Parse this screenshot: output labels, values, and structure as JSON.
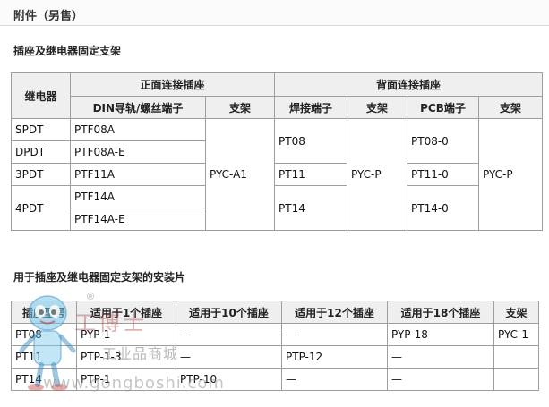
{
  "header": {
    "title": "附件（另售）"
  },
  "section1": {
    "title": "插座及继电器固定支架",
    "group_headers": {
      "relay": "继电器",
      "front": "正面连接插座",
      "back": "背面连接插座"
    },
    "sub_headers": {
      "din_screw": "DIN导轨/螺丝端子",
      "bracket1": "支架",
      "solder": "焊接端子",
      "bracket2": "支架",
      "pcb": "PCB端子",
      "bracket3": "支架"
    },
    "relays": [
      "SPDT",
      "DPDT",
      "3PDT",
      "4PDT"
    ],
    "din_sockets": [
      "PTF08A",
      "PTF08A-E",
      "PTF11A",
      "PTF14A",
      "PTF14A-E"
    ],
    "front_bracket": "PYC-A1",
    "solder_sockets": [
      "PT08",
      "PT11",
      "PT14"
    ],
    "back_bracket_solder": "PYC-P",
    "pcb_sockets": [
      "PT08-0",
      "PT11-0",
      "PT14-0"
    ],
    "back_bracket_pcb": "PYC-P"
  },
  "section2": {
    "title": "用于插座及继电器固定支架的安装片",
    "headers": [
      "插座型号",
      "适用于1个插座",
      "适用于10个插座",
      "适用于12个插座",
      "适用于18个插座",
      "支架"
    ],
    "rows": [
      [
        "PT08",
        "PYP-1",
        "—",
        "—",
        "PYP-18",
        "PYC-1"
      ],
      [
        "PT11",
        "PTP-1-3",
        "—",
        "PTP-12",
        "—",
        ""
      ],
      [
        "PT14",
        "PTP-1",
        "PTP-10",
        "—",
        "—",
        ""
      ]
    ]
  },
  "watermark": {
    "logo_text": "工博士",
    "registered": "®",
    "subtitle": "工业品商城",
    "url": "www.gongboshi.com"
  }
}
